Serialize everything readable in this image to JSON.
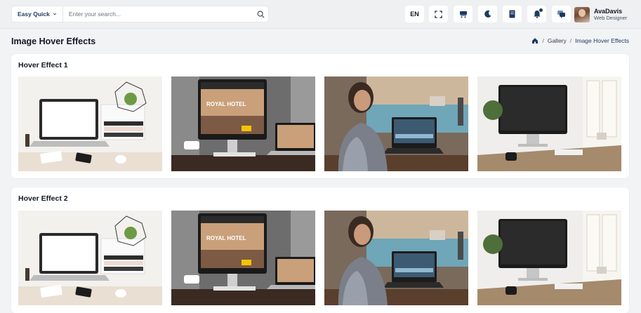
{
  "header": {
    "quick_menu_label": "Easy Quick",
    "search_placeholder": "Enter your search...",
    "language": "EN",
    "user": {
      "name": "AvaDavis",
      "role": "Web Designer"
    }
  },
  "page": {
    "title": "Image Hover Effects",
    "breadcrumb": [
      "Gallery",
      "Image Hover Effects"
    ]
  },
  "cards": [
    {
      "title": "Hover Effect 1"
    },
    {
      "title": "Hover Effect 2"
    }
  ],
  "photos": [
    {
      "icon": "laptop-desk-photo"
    },
    {
      "icon": "imac-hotel-site-photo"
    },
    {
      "icon": "woman-at-laptop-photo"
    },
    {
      "icon": "imac-window-desk-photo"
    }
  ],
  "photo_texts": [
    "ROYAL HOTEL"
  ],
  "colors": {
    "accent": "#1e3a5f",
    "background": "#f2f3f5",
    "card": "#ffffff"
  }
}
